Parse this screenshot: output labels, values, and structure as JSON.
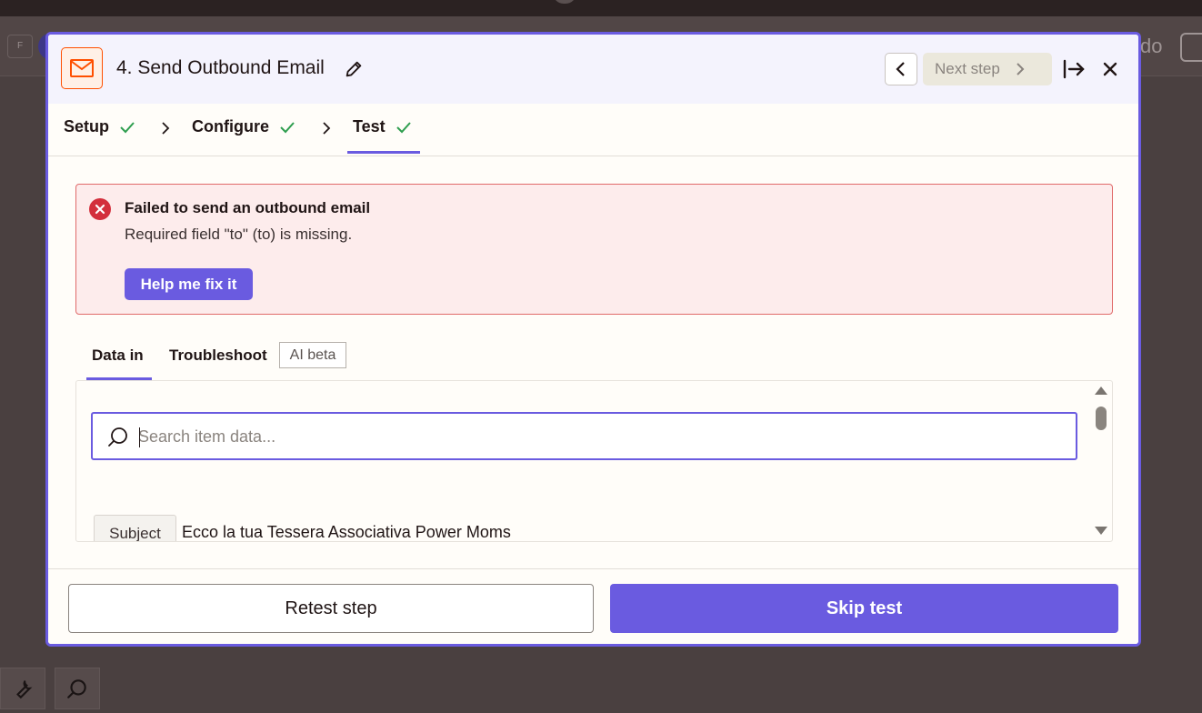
{
  "background": {
    "chip_label": "F",
    "right_text_fragment": "do"
  },
  "modal": {
    "step_title": "4. Send Outbound Email",
    "nav": {
      "next_label": "Next step"
    },
    "tabs": [
      {
        "label": "Setup",
        "status": "complete"
      },
      {
        "label": "Configure",
        "status": "complete"
      },
      {
        "label": "Test",
        "status": "complete",
        "active": true
      }
    ],
    "error": {
      "title": "Failed to send an outbound email",
      "message": "Required field \"to\" (to) is missing.",
      "help_button": "Help me fix it"
    },
    "subtabs": {
      "data_in": "Data in",
      "troubleshoot": "Troubleshoot",
      "ai_badge": "AI beta"
    },
    "data_panel": {
      "search_placeholder": "Search item data...",
      "fields": [
        {
          "key": "Subject",
          "value": "Ecco la tua Tessera Associativa Power Moms"
        }
      ]
    },
    "footer": {
      "retest_label": "Retest step",
      "skip_label": "Skip test"
    }
  },
  "colors": {
    "accent": "#6a5be0",
    "brand_orange": "#ff4f00",
    "success_green": "#2e9e4f",
    "error_red": "#d32f3c"
  }
}
